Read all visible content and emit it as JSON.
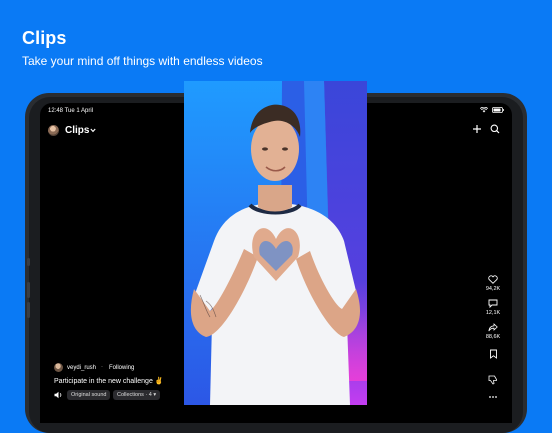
{
  "promo": {
    "title": "Clips",
    "subtitle": "Take your mind off things with endless videos"
  },
  "status_bar": {
    "time": "12:48  Tue 1 April"
  },
  "header": {
    "title": "Clips",
    "icons": [
      "avatar",
      "chevron-down-icon",
      "plus-icon",
      "search-icon"
    ]
  },
  "actions": {
    "like_count": "94,2K",
    "comment_count": "12,1K",
    "share_count": "88,6K"
  },
  "post": {
    "author": "veydi_rush",
    "separator": "·",
    "follow_label": "Following",
    "caption": "Participate in the new challenge ✌",
    "sound_label": "Original sound",
    "collections_label": "Collections · 4 ▾"
  },
  "colors": {
    "background": "#0a7af5",
    "screen": "#000000"
  }
}
